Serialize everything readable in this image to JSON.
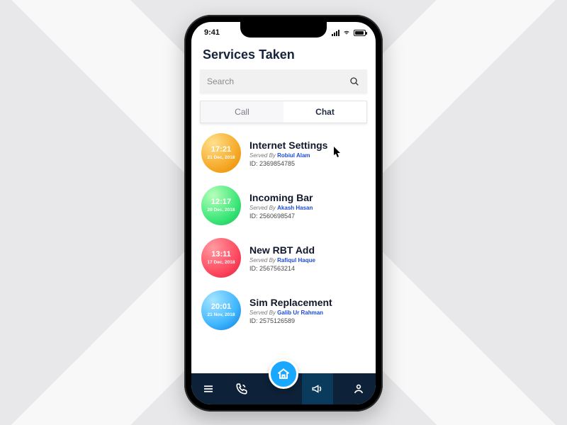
{
  "statusbar": {
    "time": "9:41"
  },
  "header": {
    "title": "Services Taken"
  },
  "search": {
    "placeholder": "Search"
  },
  "tabs": {
    "call": "Call",
    "chat": "Chat",
    "active": "chat"
  },
  "served_by_label": "Served By",
  "id_label": "ID:",
  "items": [
    {
      "time": "17:21",
      "date": "21 Dec, 2018",
      "title": "Internet Settings",
      "agent": "Robiul Alam",
      "id": "2369854785",
      "color": "g-orange"
    },
    {
      "time": "12:17",
      "date": "20 Dec, 2018",
      "title": "Incoming Bar",
      "agent": "Akash Hasan",
      "id": "2560698547",
      "color": "g-green"
    },
    {
      "time": "13:11",
      "date": "17 Dec, 2018",
      "title": "New RBT Add",
      "agent": "Rafiqul Haque",
      "id": "2567563214",
      "color": "g-red"
    },
    {
      "time": "20:01",
      "date": "21 Nov, 2018",
      "title": "Sim Replacement",
      "agent": "Galib Ur Rahman",
      "id": "2575126589",
      "color": "g-blue"
    }
  ],
  "bottom": {
    "icons": [
      "menu-icon",
      "phone-icon",
      "home-icon",
      "announce-icon",
      "account-icon"
    ],
    "active": "announce-icon"
  }
}
